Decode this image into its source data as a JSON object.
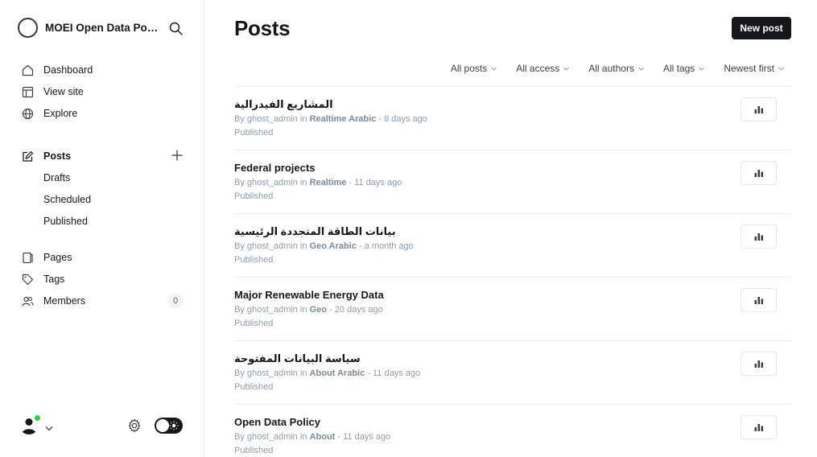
{
  "brand": {
    "title": "MOEI Open Data Porta..."
  },
  "sidebar": {
    "nav": [
      {
        "label": "Dashboard",
        "icon": "home-icon"
      },
      {
        "label": "View site",
        "icon": "layout-icon"
      },
      {
        "label": "Explore",
        "icon": "globe-icon"
      }
    ],
    "posts_label": "Posts",
    "sub_items": [
      "Drafts",
      "Scheduled",
      "Published"
    ],
    "nav2": [
      {
        "label": "Pages",
        "icon": "pages-icon"
      },
      {
        "label": "Tags",
        "icon": "tag-icon"
      },
      {
        "label": "Members",
        "icon": "members-icon"
      }
    ],
    "members_count": "0"
  },
  "main": {
    "title": "Posts",
    "new_post_label": "New post",
    "filters": [
      "All posts",
      "All access",
      "All authors",
      "All tags",
      "Newest first"
    ]
  },
  "posts": [
    {
      "title": "المشاريع الفيدرالية",
      "by": "By ghost_admin in ",
      "tag": "Realtime Arabic",
      "time": " - 8 days ago",
      "status": "Published"
    },
    {
      "title": "Federal projects",
      "by": "By ghost_admin in ",
      "tag": "Realtime",
      "time": " - 11 days ago",
      "status": "Published"
    },
    {
      "title": "بيانات الطاقة المتجددة الرئيسية",
      "by": "By ghost_admin in ",
      "tag": "Geo Arabic",
      "time": " - a month ago",
      "status": "Published"
    },
    {
      "title": "Major Renewable Energy Data",
      "by": "By ghost_admin in ",
      "tag": "Geo",
      "time": " - 20 days ago",
      "status": "Published"
    },
    {
      "title": "سياسة البيانات المفتوحة",
      "by": "By ghost_admin in ",
      "tag": "About Arabic",
      "time": " - 11 days ago",
      "status": "Published"
    },
    {
      "title": "Open Data Policy",
      "by": "By ghost_admin in ",
      "tag": "About",
      "time": " - 11 days ago",
      "status": "Published"
    }
  ],
  "colors": {
    "accent": "#15171a",
    "online": "#30cf43",
    "meta": "#8e9cac"
  }
}
